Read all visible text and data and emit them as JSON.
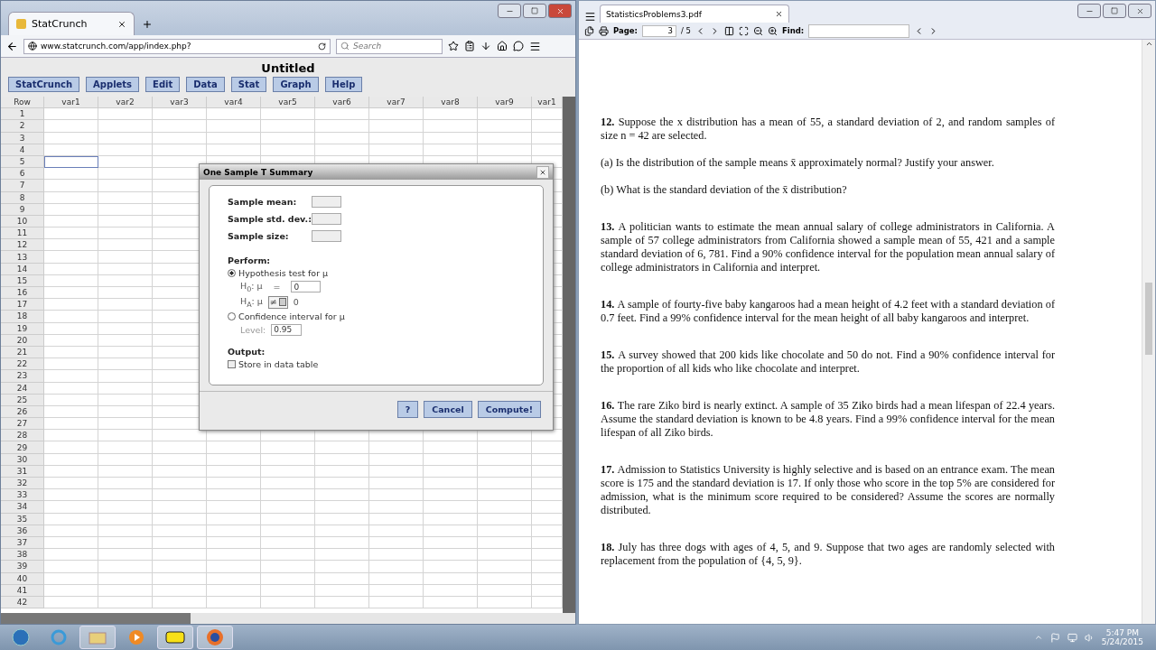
{
  "browser": {
    "tab_title": "StatCrunch",
    "url": "www.statcrunch.com/app/index.php?",
    "search_placeholder": "Search"
  },
  "app": {
    "title": "Untitled",
    "menu": [
      "StatCrunch",
      "Applets",
      "Edit",
      "Data",
      "Stat",
      "Graph",
      "Help"
    ],
    "grid": {
      "corner": "Row",
      "columns": [
        "var1",
        "var2",
        "var3",
        "var4",
        "var5",
        "var6",
        "var7",
        "var8",
        "var9",
        "var1"
      ],
      "rows": [
        {
          "label": "1",
          "cell_selected": false
        },
        {
          "label": "2",
          "cell_selected": false
        },
        {
          "label": "3",
          "cell_selected": false
        },
        {
          "label": "4",
          "cell_selected": false
        },
        {
          "label": "5",
          "cell_selected": true
        },
        {
          "label": "6",
          "cell_selected": false
        },
        {
          "label": "7",
          "cell_selected": false
        },
        {
          "label": "8",
          "cell_selected": false
        },
        {
          "label": "9",
          "cell_selected": false
        },
        {
          "label": "10",
          "cell_selected": false
        },
        {
          "label": "11",
          "cell_selected": false
        },
        {
          "label": "12",
          "cell_selected": false
        },
        {
          "label": "13",
          "cell_selected": false
        },
        {
          "label": "14",
          "cell_selected": false
        },
        {
          "label": "15",
          "cell_selected": false
        },
        {
          "label": "16",
          "cell_selected": false
        },
        {
          "label": "17",
          "cell_selected": false
        },
        {
          "label": "18",
          "cell_selected": false
        },
        {
          "label": "19",
          "cell_selected": false
        },
        {
          "label": "20",
          "cell_selected": false
        },
        {
          "label": "21",
          "cell_selected": false
        },
        {
          "label": "22",
          "cell_selected": false
        },
        {
          "label": "23",
          "cell_selected": false
        },
        {
          "label": "24",
          "cell_selected": false
        },
        {
          "label": "25",
          "cell_selected": false
        },
        {
          "label": "26",
          "cell_selected": false
        },
        {
          "label": "27",
          "cell_selected": false
        },
        {
          "label": "28",
          "cell_selected": false
        },
        {
          "label": "29",
          "cell_selected": false
        },
        {
          "label": "30",
          "cell_selected": false
        },
        {
          "label": "31",
          "cell_selected": false
        },
        {
          "label": "32",
          "cell_selected": false
        },
        {
          "label": "33",
          "cell_selected": false
        },
        {
          "label": "34",
          "cell_selected": false
        },
        {
          "label": "35",
          "cell_selected": false
        },
        {
          "label": "36",
          "cell_selected": false
        },
        {
          "label": "37",
          "cell_selected": false
        },
        {
          "label": "38",
          "cell_selected": false
        },
        {
          "label": "39",
          "cell_selected": false
        },
        {
          "label": "40",
          "cell_selected": false
        },
        {
          "label": "41",
          "cell_selected": false
        },
        {
          "label": "42",
          "cell_selected": false
        }
      ]
    },
    "dialog": {
      "title": "One Sample T Summary",
      "fields": [
        "Sample mean:",
        "Sample std. dev.:",
        "Sample size:"
      ],
      "perform_label": "Perform:",
      "options": [
        {
          "label": "Hypothesis test for μ",
          "selected": true
        },
        {
          "label": "Confidence interval for μ",
          "selected": false
        }
      ],
      "h0": {
        "label": "H$_{0}$: μ",
        "op": "=",
        "value": "0"
      },
      "ha": {
        "label": "H$_{A}$: μ",
        "op": "≠",
        "value": "0"
      },
      "level": {
        "label": "Level:",
        "value": "0.95"
      },
      "output_label": "Output:",
      "store": {
        "label": "Store in data table",
        "checked": false
      },
      "buttons": [
        "?",
        "Cancel",
        "Compute!"
      ]
    }
  },
  "pdf": {
    "file": "StatisticsProblems3.pdf",
    "page_label": "Page:",
    "page": "3",
    "total": "/ 5",
    "find_label": "Find:",
    "problems": [
      {
        "number": "12.",
        "paragraphs": [
          "Suppose the x distribution has a mean of 55, a standard deviation of 2, and random samples of size n = 42 are selected.",
          "(a) Is the distribution of the sample means x̄ approximately normal? Justify your answer.",
          "(b) What is the standard deviation of the x̄ distribution?"
        ]
      },
      {
        "number": "13.",
        "paragraphs": [
          "A politician wants to estimate the mean annual salary of college administrators in California. A sample of 57 college administrators from California showed a sample mean of 55, 421 and a sample standard deviation of 6, 781. Find a 90% confidence interval for the population mean annual salary of college administrators in California and interpret."
        ]
      },
      {
        "number": "14.",
        "paragraphs": [
          "A sample of fourty-five baby kangaroos had a mean height of 4.2 feet with a standard deviation of 0.7 feet. Find a 99% confidence interval for the mean height of all baby kangaroos and interpret."
        ]
      },
      {
        "number": "15.",
        "paragraphs": [
          "A survey showed that 200 kids like chocolate and 50 do not. Find a 90% confidence interval for the proportion of all kids who like chocolate and interpret."
        ]
      },
      {
        "number": "16.",
        "paragraphs": [
          "The rare Ziko bird is nearly extinct. A sample of 35 Ziko birds had a mean lifespan of 22.4 years. Assume the standard deviation is known to be 4.8 years. Find a 99% confidence interval for the mean lifespan of all Ziko birds."
        ]
      },
      {
        "number": "17.",
        "paragraphs": [
          "Admission to Statistics University is highly selective and is based on an entrance exam. The mean score is 175 and the standard deviation is 17. If only those who score in the top 5% are considered for admission, what is the minimum score required to be considered? Assume the scores are normally distributed."
        ]
      },
      {
        "number": "18.",
        "paragraphs": [
          "July has three dogs with ages of 4, 5, and 9. Suppose that two ages are randomly selected with replacement from the population of {4, 5, 9}."
        ]
      }
    ]
  },
  "taskbar": {
    "time": "5:47 PM",
    "date": "5/24/2015"
  }
}
